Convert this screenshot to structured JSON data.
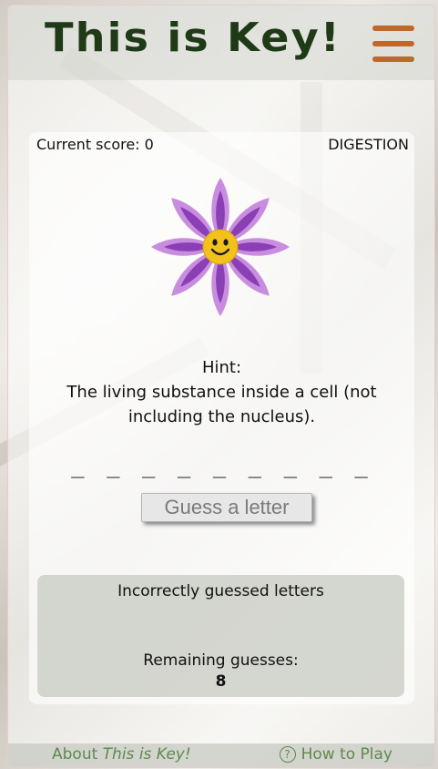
{
  "header": {
    "title": "This is Key!",
    "menu_icon": "hamburger-menu-icon",
    "accent_color": "#c0672a",
    "title_color": "#1f3a17"
  },
  "game": {
    "score_label": "Current score: 0",
    "category": "DIGESTION",
    "hint_label": "Hint:",
    "hint_text": "The living substance inside a cell (not including the nucleus).",
    "word_blanks": "_ _ _ _ _ _ _ _ _",
    "guess_button": "Guess a letter",
    "incorrect_label": "Incorrectly guessed letters",
    "incorrect_letters": "",
    "remaining_label": "Remaining guesses:",
    "remaining_count": "8",
    "image_icon": "smiling-flower-icon"
  },
  "footer": {
    "about_prefix": "About ",
    "about_title": "This is Key!",
    "howto_label": "How to Play",
    "howto_icon": "question-circle-icon",
    "link_color": "#5d8a4c"
  }
}
